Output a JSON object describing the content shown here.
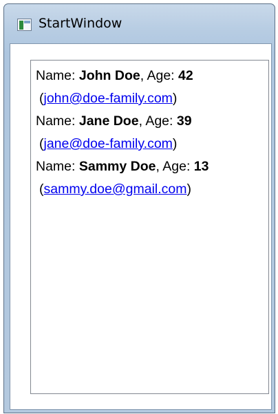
{
  "window": {
    "title": "StartWindow"
  },
  "people": [
    {
      "name_label": "Name: ",
      "name": "John Doe",
      "age_label": ", Age: ",
      "age": "42",
      "open": "(",
      "email": "john@doe-family.com",
      "close": ")"
    },
    {
      "name_label": "Name: ",
      "name": "Jane Doe",
      "age_label": ", Age: ",
      "age": "39",
      "open": "(",
      "email": "jane@doe-family.com",
      "close": ")"
    },
    {
      "name_label": "Name: ",
      "name": "Sammy Doe",
      "age_label": ", Age: ",
      "age": "13",
      "open": "(",
      "email": "sammy.doe@gmail.com",
      "close": ")"
    }
  ],
  "colors": {
    "link": "#0000ee",
    "titlebar": "#b8cde3"
  },
  "icons": {
    "app": "wpf-window-icon"
  }
}
